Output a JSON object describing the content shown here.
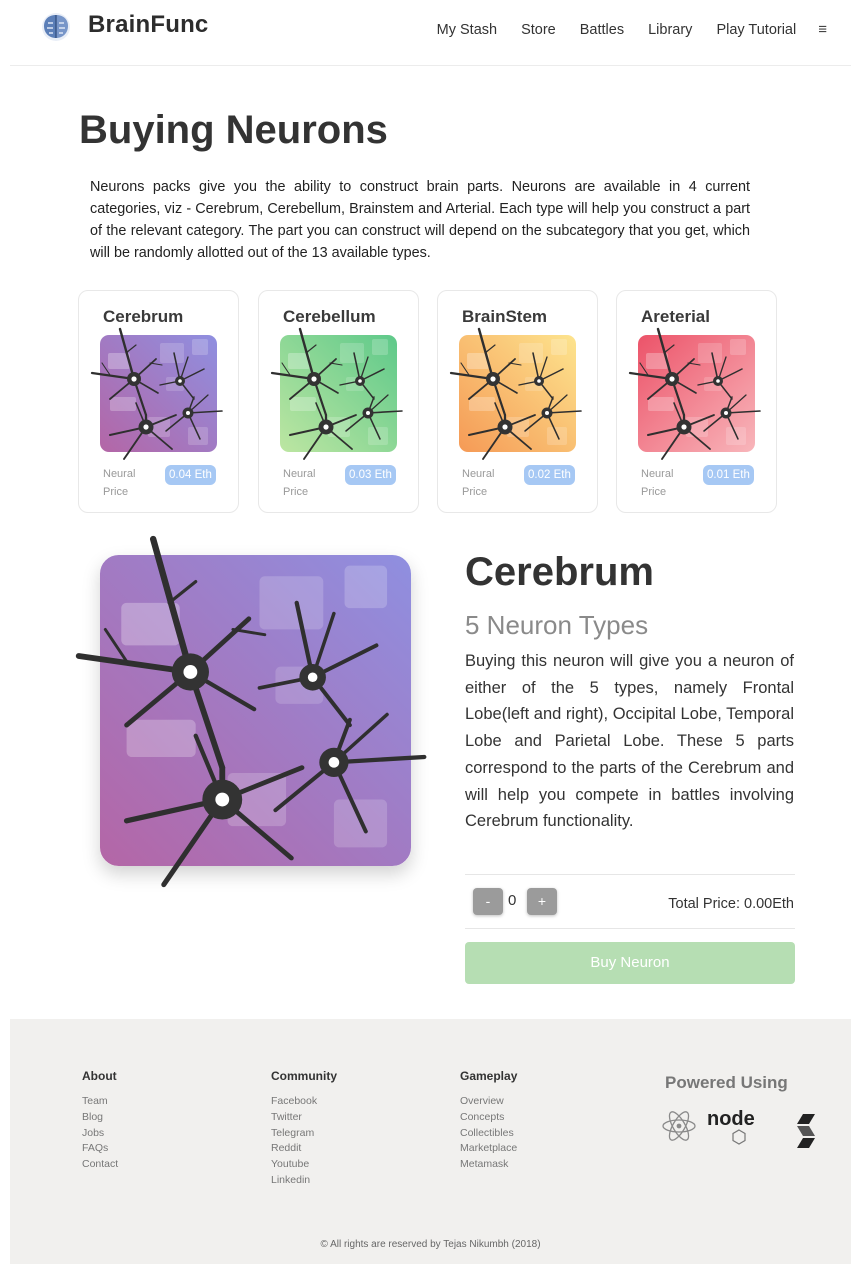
{
  "header": {
    "brand": "BrainFunc",
    "logo_icon": "brain-icon",
    "nav": [
      "My Stash",
      "Store",
      "Battles",
      "Library",
      "Play Tutorial"
    ],
    "menu_icon": "hamburger-menu-icon",
    "menu_glyph": "≡"
  },
  "page": {
    "title": "Buying Neurons",
    "intro": "Neurons packs give you the ability to construct brain parts. Neurons are available in 4 current categories, viz - Cerebrum, Cerebellum, Brainstem and Arterial. Each type will help you construct a part of the relevant category. The part you can construct will depend on the subcategory that you get, which will be randomly allotted out of the 13 available types."
  },
  "cards": [
    {
      "title": "Cerebrum",
      "price_label": "Neural Price",
      "price": "0.04 Eth",
      "gradient": [
        "#8f7fd9",
        "#b06aa8"
      ]
    },
    {
      "title": "Cerebellum",
      "price_label": "Neural Price",
      "price": "0.03 Eth",
      "gradient": [
        "#6cc98a",
        "#b6e3a0"
      ]
    },
    {
      "title": "BrainStem",
      "price_label": "Neural Price",
      "price": "0.02 Eth",
      "gradient": [
        "#f4a259",
        "#fde08a"
      ]
    },
    {
      "title": "Areterial",
      "price_label": "Neural Price",
      "price": "0.01 Eth",
      "gradient": [
        "#ee5a6f",
        "#f8b1b7"
      ]
    }
  ],
  "detail": {
    "title": "Cerebrum",
    "subtitle": "5 Neuron Types",
    "description": "Buying this neuron will give you a neuron of either of the 5 types, namely Frontal Lobe(left and right), Occipital Lobe, Temporal Lobe and Parietal Lobe. These 5 parts correspond to the parts of the Cerebrum and will help you compete in battles involving Cerebrum functionality.",
    "minus": "-",
    "plus": "+",
    "quantity": "0",
    "total_price": "Total Price: 0.00Eth",
    "buy_label": "Buy Neuron"
  },
  "footer": {
    "columns": [
      {
        "heading": "About",
        "links": [
          "Team",
          "Blog",
          "Jobs",
          "FAQs",
          "Contact"
        ]
      },
      {
        "heading": "Community",
        "links": [
          "Facebook",
          "Twitter",
          "Telegram",
          "Reddit",
          "Youtube",
          "Linkedin"
        ]
      },
      {
        "heading": "Gameplay",
        "links": [
          "Overview",
          "Concepts",
          "Collectibles",
          "Marketplace",
          "Metamask"
        ]
      }
    ],
    "powered_title": "Powered Using",
    "tech_icons": [
      "react-icon",
      "nodejs-icon",
      "solidity-icon"
    ],
    "node_text": "node",
    "copyright": "© All rights are reserved by Tejas Nikumbh (2018)"
  }
}
